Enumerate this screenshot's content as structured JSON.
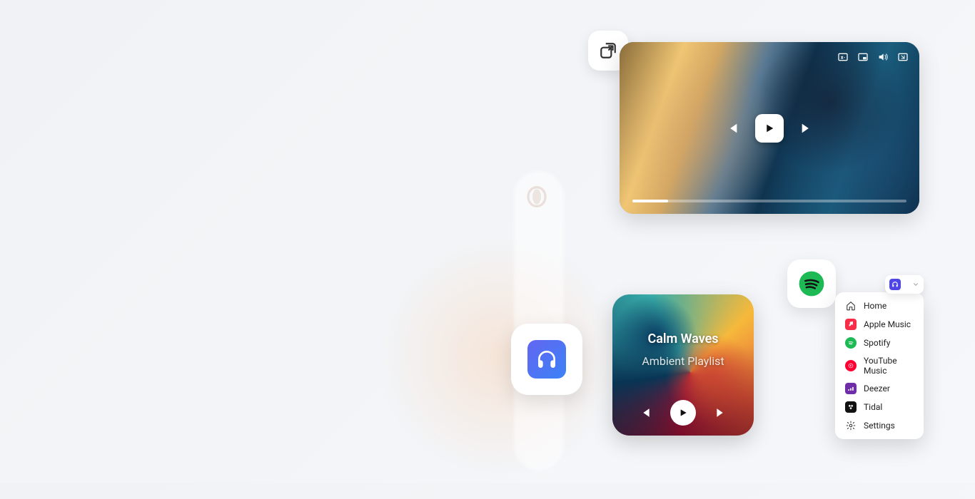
{
  "album": {
    "title": "Calm Waves",
    "subtitle": "Ambient Playlist"
  },
  "popover": {
    "items": [
      "Home",
      "Apple Music",
      "Spotify",
      "YouTube Music",
      "Deezer",
      "Tidal",
      "Settings"
    ]
  },
  "video": {
    "progress_percent": 13
  }
}
